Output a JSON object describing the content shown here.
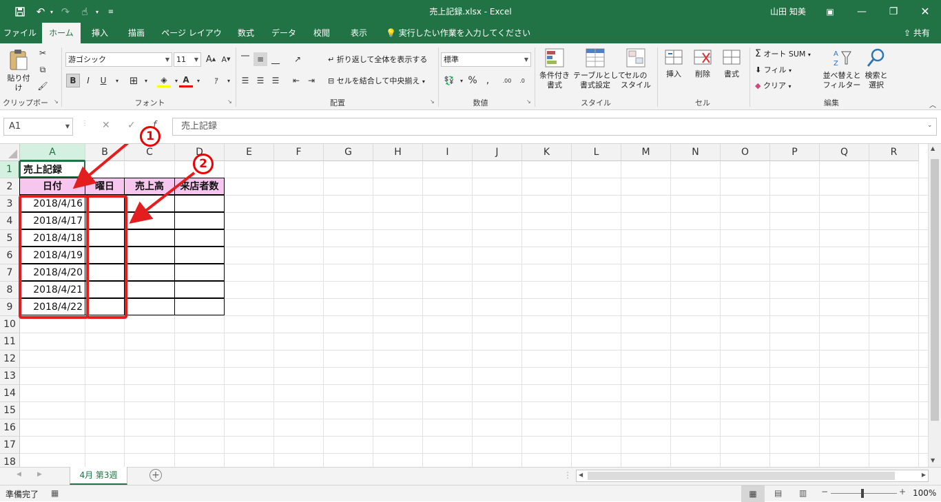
{
  "titlebar": {
    "title": "売上記録.xlsx  -  Excel",
    "user": "山田 知美"
  },
  "tabs": [
    "ファイル",
    "ホーム",
    "挿入",
    "描画",
    "ページ レイアウト",
    "数式",
    "データ",
    "校閲",
    "表示"
  ],
  "tellme": "実行したい作業を入力してください",
  "share": "共有",
  "ribbon": {
    "clipboard": {
      "paste": "貼り付け",
      "label": "クリップボード"
    },
    "font": {
      "name": "游ゴシック",
      "size": "11",
      "bold": "B",
      "italic": "I",
      "underline": "U",
      "grow": "A",
      "shrink": "A",
      "color_a": "A",
      "label": "フォント"
    },
    "align": {
      "wrap": "折り返して全体を表示する",
      "merge": "セルを結合して中央揃え",
      "label": "配置"
    },
    "number": {
      "format": "標準",
      "percent": "%",
      "comma": ",",
      "dec_up": ".00",
      "dec_down": ".0",
      "label": "数値"
    },
    "styles": {
      "cond": "条件付き\n書式",
      "table": "テーブルとして\n書式設定",
      "cell": "セルの\nスタイル",
      "label": "スタイル"
    },
    "cells": {
      "insert": "挿入",
      "delete": "削除",
      "format": "書式",
      "label": "セル"
    },
    "editing": {
      "autosum": "オート SUM",
      "fill": "フィル",
      "clear": "クリア",
      "sort": "並べ替えと\nフィルター",
      "find": "検索と\n選択",
      "label": "編集"
    }
  },
  "formula_bar": {
    "namebox": "A1",
    "content": "売上記録"
  },
  "sheet": {
    "columns": [
      "A",
      "B",
      "C",
      "D",
      "E",
      "F",
      "G",
      "H",
      "I",
      "J",
      "K",
      "L",
      "M",
      "N",
      "O",
      "P",
      "Q",
      "R"
    ],
    "rows": [
      "1",
      "2",
      "3",
      "4",
      "5",
      "6",
      "7",
      "8",
      "9",
      "10",
      "11",
      "12",
      "13",
      "14",
      "15",
      "16",
      "17",
      "18"
    ],
    "a1": "売上記録",
    "headers": [
      "日付",
      "曜日",
      "売上高",
      "来店者数"
    ],
    "dates": [
      "2018/4/16",
      "2018/4/17",
      "2018/4/18",
      "2018/4/19",
      "2018/4/20",
      "2018/4/21",
      "2018/4/22"
    ]
  },
  "sheet_tab": "4月 第3週",
  "status": {
    "ready": "準備完了",
    "zoom": "100%"
  },
  "annotations": {
    "badge1": "1",
    "badge2": "2"
  },
  "colors": {
    "excel_green": "#217346",
    "header_fill": "#f6c6ef",
    "annotation_red": "#e41e1e"
  }
}
